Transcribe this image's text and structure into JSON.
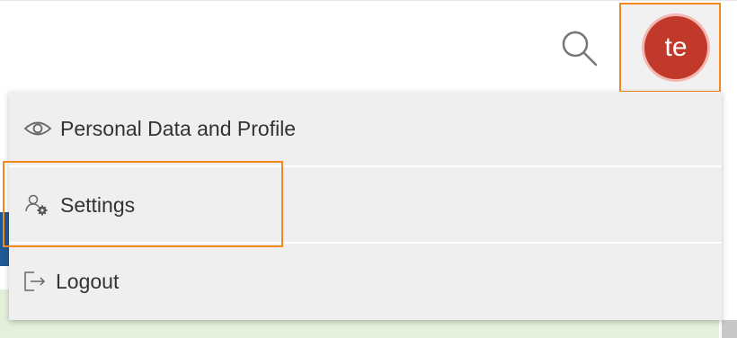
{
  "header": {
    "search_icon": "search-icon",
    "avatar_initials": "te",
    "avatar_color": "#c0392b",
    "highlight_color": "#f08a1e"
  },
  "menu": {
    "items": [
      {
        "label": "Personal Data and Profile",
        "icon": "eye-icon"
      },
      {
        "label": "Settings",
        "icon": "user-settings-icon"
      },
      {
        "label": "Logout",
        "icon": "logout-icon"
      }
    ]
  }
}
